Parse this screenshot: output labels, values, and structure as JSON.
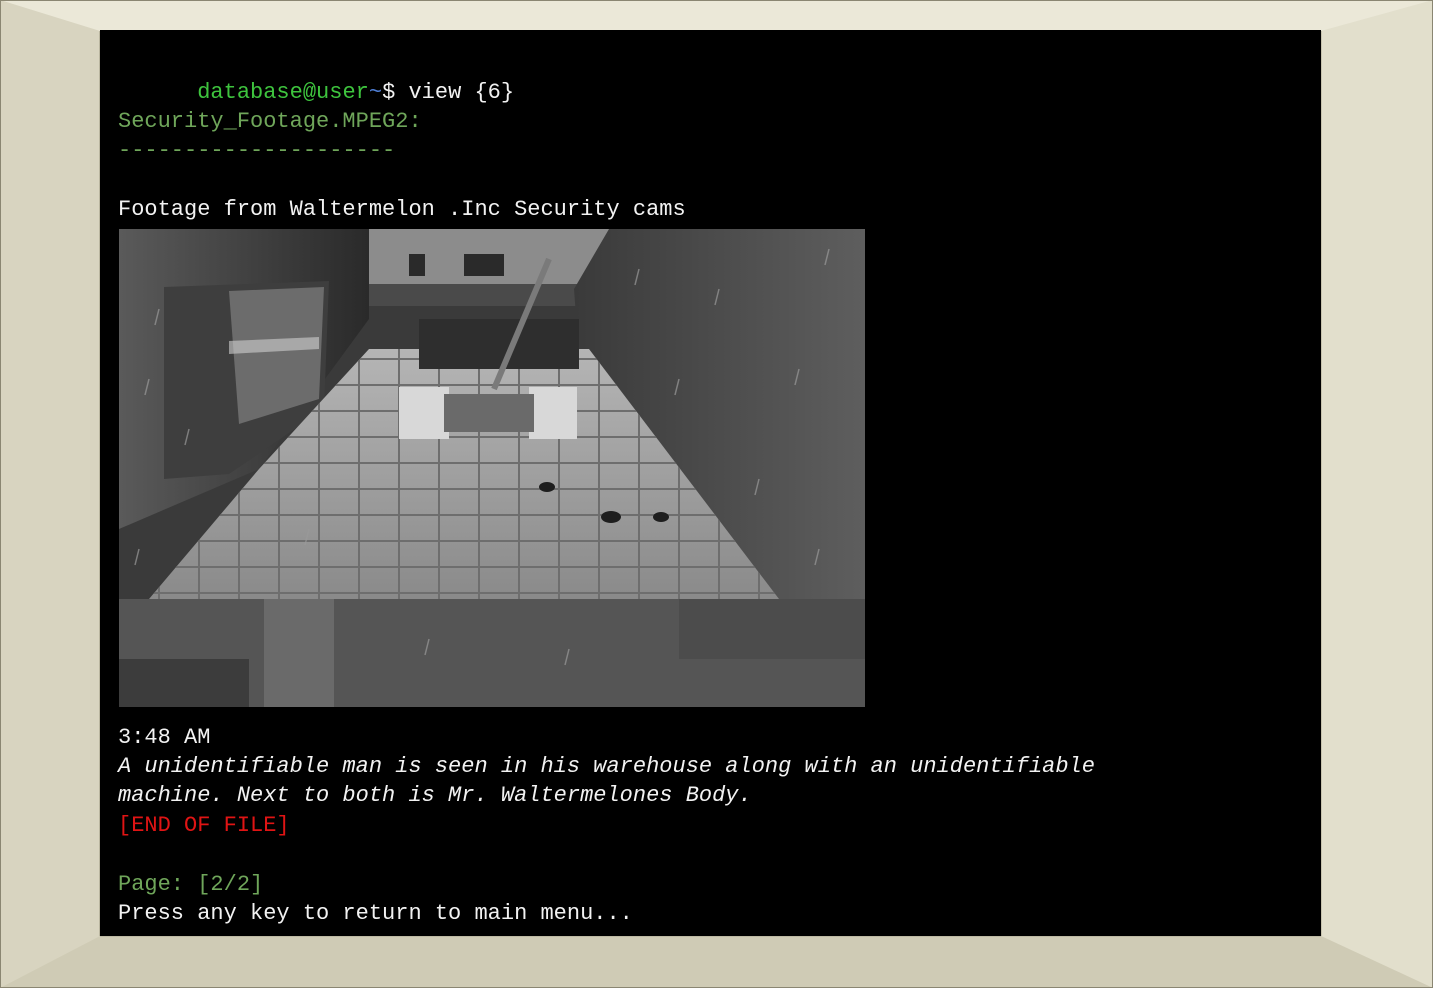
{
  "terminal": {
    "prompt_user": "database@user",
    "prompt_tilde": "~",
    "prompt_symbol": "$ ",
    "command": "view {6}",
    "file_name": "Security_Footage.MPEG2:",
    "divider": "---------------------",
    "description": "Footage from Waltermelon .Inc Security cams",
    "timestamp": "3:48 AM",
    "caption_line1": "A unidentifiable man is seen in his warehouse along with an unidentifiable",
    "caption_line2": "machine. Next to both is Mr. Waltermelones Body.",
    "eof_marker": "[END OF FILE]",
    "page_indicator": "Page: [2/2]",
    "return_prompt": "Press any key to return to main menu..."
  },
  "colors": {
    "screen_bg": "#000000",
    "prompt_green": "#3ec43e",
    "tilde_blue": "#4f7fd6",
    "dim_green": "#6fa65a",
    "error_red": "#e01414",
    "bezel": "#e3e0cf"
  }
}
